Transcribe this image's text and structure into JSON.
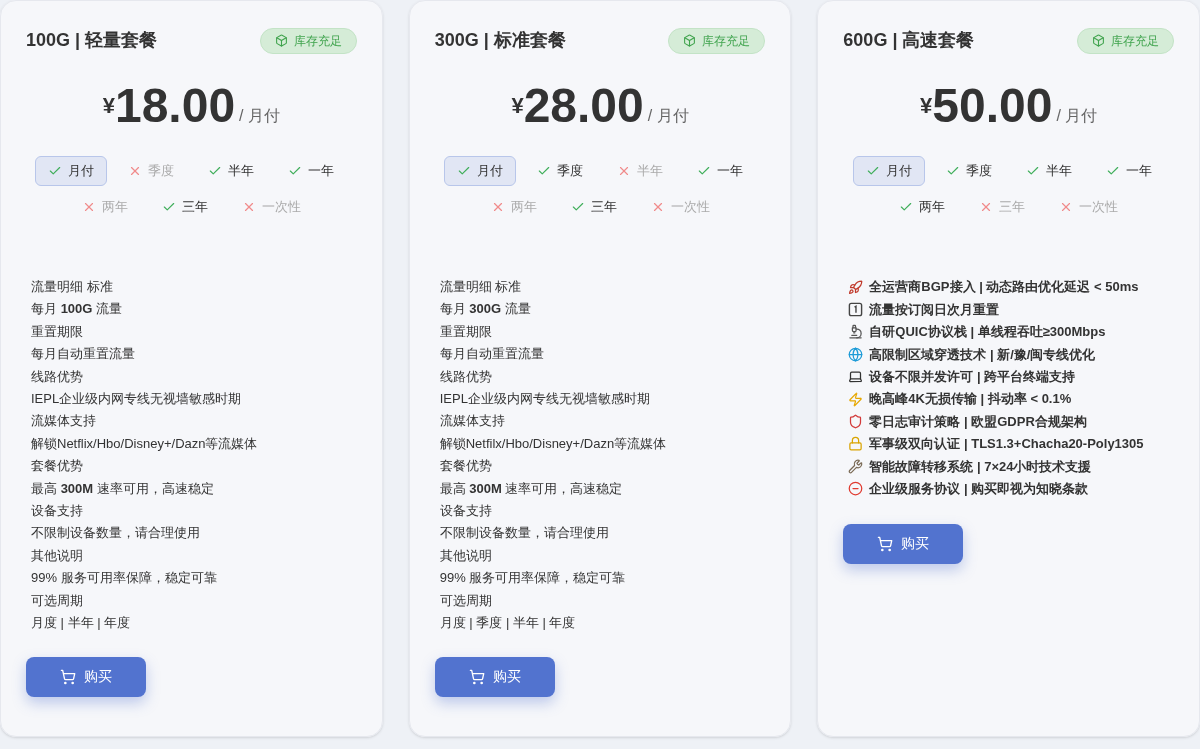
{
  "plans": [
    {
      "title": "100G | 轻量套餐",
      "badge": "库存充足",
      "currency": "¥",
      "price": "18.00",
      "unit": "/ 月付",
      "periods": [
        {
          "label": "月付",
          "available": true,
          "selected": true
        },
        {
          "label": "季度",
          "available": false,
          "selected": false
        },
        {
          "label": "半年",
          "available": true,
          "selected": false
        },
        {
          "label": "一年",
          "available": true,
          "selected": false
        },
        {
          "label": "两年",
          "available": false,
          "selected": false
        },
        {
          "label": "三年",
          "available": true,
          "selected": false
        },
        {
          "label": "一次性",
          "available": false,
          "selected": false
        }
      ],
      "kind": "plain",
      "features": [
        "流量明细 标准",
        "每月 **100G** 流量",
        "重置期限",
        "每月自动重置流量",
        "线路优势",
        "IEPL企业级内网专线无视墙敏感时期",
        "流媒体支持",
        "解锁Netflix/Hbo/Disney+/Dazn等流媒体",
        "套餐优势",
        "最高 **300M** 速率可用，高速稳定",
        "设备支持",
        "不限制设备数量，请合理使用",
        "其他说明",
        "99% 服务可用率保障，稳定可靠",
        "可选周期",
        "月度 | 半年 | 年度"
      ],
      "button": "购买"
    },
    {
      "title": "300G | 标准套餐",
      "badge": "库存充足",
      "currency": "¥",
      "price": "28.00",
      "unit": "/ 月付",
      "periods": [
        {
          "label": "月付",
          "available": true,
          "selected": true
        },
        {
          "label": "季度",
          "available": true,
          "selected": false
        },
        {
          "label": "半年",
          "available": false,
          "selected": false
        },
        {
          "label": "一年",
          "available": true,
          "selected": false
        },
        {
          "label": "两年",
          "available": false,
          "selected": false
        },
        {
          "label": "三年",
          "available": true,
          "selected": false
        },
        {
          "label": "一次性",
          "available": false,
          "selected": false
        }
      ],
      "kind": "plain",
      "features": [
        "流量明细 标准",
        "每月 **300G** 流量",
        "重置期限",
        "每月自动重置流量",
        "线路优势",
        "IEPL企业级内网专线无视墙敏感时期",
        "流媒体支持",
        "解锁Netfilx/Hbo/Disney+/Dazn等流媒体",
        "套餐优势",
        "最高 **300M** 速率可用，高速稳定",
        "设备支持",
        "不限制设备数量，请合理使用",
        "其他说明",
        "99% 服务可用率保障，稳定可靠",
        "可选周期",
        "月度 | 季度 | 半年 | 年度"
      ],
      "button": "购买"
    },
    {
      "title": "600G | 高速套餐",
      "badge": "库存充足",
      "currency": "¥",
      "price": "50.00",
      "unit": "/ 月付",
      "periods": [
        {
          "label": "月付",
          "available": true,
          "selected": true
        },
        {
          "label": "季度",
          "available": true,
          "selected": false
        },
        {
          "label": "半年",
          "available": true,
          "selected": false
        },
        {
          "label": "一年",
          "available": true,
          "selected": false
        },
        {
          "label": "两年",
          "available": true,
          "selected": false
        },
        {
          "label": "三年",
          "available": false,
          "selected": false
        },
        {
          "label": "一次性",
          "available": false,
          "selected": false
        }
      ],
      "kind": "icons",
      "features": [
        "全运营商BGP接入 | 动态路由优化延迟 < 50ms",
        "流量按订阅日次月重置",
        "自研QUIC协议栈 | 单线程吞吐≥300Mbps",
        "高限制区域穿透技术 | 新/豫/闽专线优化",
        "设备不限并发许可 | 跨平台终端支持",
        "晚高峰4K无损传输 | 抖动率 < 0.1%",
        "零日志审计策略 | 欧盟GDPR合规架构",
        "军事级双向认证 | TLS1.3+Chacha20-Poly1305",
        "智能故障转移系统 | 7×24小时技术支援",
        "企业级服务协议 | 购买即视为知晓条款"
      ],
      "button": "购买"
    }
  ]
}
